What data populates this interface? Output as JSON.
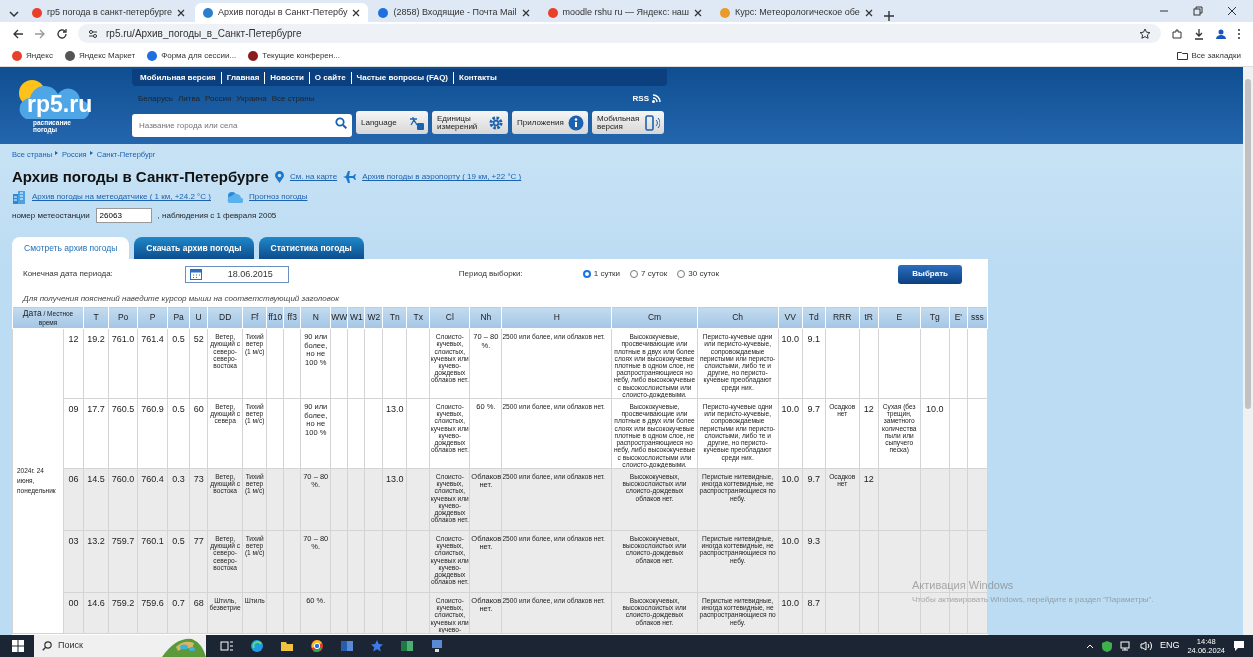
{
  "browser": {
    "tabs": [
      {
        "title": "rp5 погода в санкт-петербурге",
        "selected": false,
        "color": "#e8402a"
      },
      {
        "title": "Архив погоды в Санкт-Петербу",
        "selected": true,
        "color": "#2a7fd0"
      },
      {
        "title": "(2858) Входящие - Почта Mail",
        "selected": false,
        "color": "#1e6fe0"
      },
      {
        "title": "moodle rshu ru — Яндекс: наш",
        "selected": false,
        "color": "#e8402a"
      },
      {
        "title": "Курс: Метеорологическое обе",
        "selected": false,
        "color": "#e89a2a"
      }
    ],
    "address": "rp5.ru/Архив_погоды_в_Санкт-Петербурге",
    "bookmarks": [
      {
        "label": "Яндекс",
        "color": "#e8402a"
      },
      {
        "label": "Яндекс Маркет",
        "color": "#555555"
      },
      {
        "label": "Форма для сессии...",
        "color": "#1e6fe0"
      },
      {
        "label": "Текущие конферен...",
        "color": "#8a1c1c"
      }
    ],
    "all_bookmarks": "Все закладки"
  },
  "site": {
    "logo": "rp5.ru",
    "logo_sub": "расписание погоды",
    "top_menu": [
      "Мобильная версия",
      "Главная",
      "Новости",
      "О сайте",
      "Частые вопросы (FAQ)",
      "Контакты"
    ],
    "countries": [
      "Беларусь",
      "Литва",
      "Россия",
      "Украина",
      "Все страны"
    ],
    "rss": "RSS",
    "search_placeholder": "Название города или села",
    "header_buttons": [
      {
        "label": "Language",
        "kind": "translate"
      },
      {
        "label": "Единицы измерений",
        "kind": "gear"
      },
      {
        "label": "Приложения",
        "kind": "info"
      },
      {
        "label": "Мобильная версия",
        "kind": "phone"
      }
    ]
  },
  "breadcrumbs": [
    "Все страны",
    "Россия",
    "Санкт-Петербург"
  ],
  "title": "Архив погоды в Санкт-Петербурге",
  "map_link": "См. на карте",
  "airport_link": "Архив погоды в аэропорту ( 19 км, +22 °C )",
  "sensor_link": "Архив погоды на метеодатчике ( 1 км, +24.2 °C )",
  "forecast_link": "Прогноз погоды",
  "station_label": "номер метеостанции",
  "station": "26063",
  "since": ", наблюдения с 1 февраля 2005",
  "archive_tabs": [
    {
      "label": "Смотреть архив погоды",
      "selected": true
    },
    {
      "label": "Скачать архив погоды",
      "selected": false
    },
    {
      "label": "Статистика погоды",
      "selected": false
    }
  ],
  "form": {
    "end_date_label": "Конечная дата периода:",
    "date": "18.06.2015",
    "period_label": "Период выборки:",
    "periods": [
      {
        "label": "1 сутки",
        "selected": true
      },
      {
        "label": "7 суток",
        "selected": false
      },
      {
        "label": "30 суток",
        "selected": false
      }
    ],
    "submit": "Выбрать"
  },
  "hint": "Для получения пояснений наведите курсор мыши на соответствующий заголовок",
  "table": {
    "columns": [
      {
        "label": "Дата",
        "sub": "/ Местное время"
      },
      {
        "label": "T"
      },
      {
        "label": "Po"
      },
      {
        "label": "P"
      },
      {
        "label": "Pa"
      },
      {
        "label": "U"
      },
      {
        "label": "DD"
      },
      {
        "label": "Ff"
      },
      {
        "label": "ff10"
      },
      {
        "label": "ff3"
      },
      {
        "label": "N"
      },
      {
        "label": "WW"
      },
      {
        "label": "W1"
      },
      {
        "label": "W2"
      },
      {
        "label": "Tn"
      },
      {
        "label": "Tx"
      },
      {
        "label": "Cl"
      },
      {
        "label": "Nh"
      },
      {
        "label": "H"
      },
      {
        "label": "Cm"
      },
      {
        "label": "Ch"
      },
      {
        "label": "VV"
      },
      {
        "label": "Td"
      },
      {
        "label": "RRR"
      },
      {
        "label": "tR"
      },
      {
        "label": "E"
      },
      {
        "label": "Tg"
      },
      {
        "label": "E'"
      },
      {
        "label": "sss"
      }
    ],
    "day": "2024г. 24 июня, понедельник",
    "rows": [
      {
        "shaded": false,
        "cells": [
          "12",
          "19.2",
          "761.0",
          "761.4",
          "0.5",
          "52",
          "Ветер, дующий с северо-северо-востока",
          "Тихий ветер (1 м/с)",
          null,
          null,
          "90 или более, но не 100 %",
          null,
          null,
          null,
          null,
          null,
          "Слоисто-кучевых, слоистых, кучевых или кучево-дождевых облаков нет.",
          "70 – 80 %.",
          "2500 или более, или облаков нет.",
          "Высококучевые, просвечивающие или плотные в двух или более слоях или высококучевые плотные в одном слое, не распространяющиеся но небу, либо высококучевые с высокослоистыми или слоисто-дождевыми.",
          "Перисто-кучевые одни или перисто-кучевые, сопровождаемые перистыми или перисто-слоистыми, либо те и другие, но перисто-кучевые преобладают среди них.",
          "10.0",
          "9.1",
          null,
          null,
          null,
          null,
          null,
          null
        ]
      },
      {
        "shaded": false,
        "cells": [
          "09",
          "17.7",
          "760.5",
          "760.9",
          "0.5",
          "60",
          "Ветер, дующий с севера",
          "Тихий ветер (1 м/с)",
          null,
          null,
          "90 или более, но не 100 %",
          null,
          null,
          null,
          "13.0",
          null,
          "Слоисто-кучевых, слоистых, кучевых или кучево-дождевых облаков нет.",
          "60 %.",
          "2500 или более, или облаков нет.",
          "Высококучевые, просвечивающие или плотные в двух или более слоях или высококучевые плотные в одном слое, не распространяющиеся но небу, либо высококучевые с высокослоистыми или слоисто-дождевыми.",
          "Перисто-кучевые одни или перисто-кучевые, сопровождаемые перистыми или перисто-слоистыми, либо те и другие, но перисто-кучевые преобладают среди них.",
          "10.0",
          "9.7",
          "Осадков нет",
          "12",
          "Сухая (без трещин, заметного количества пыли или сыпучего песка)",
          "10.0",
          null,
          null
        ]
      },
      {
        "shaded": true,
        "cells": [
          "06",
          "14.5",
          "760.0",
          "760.4",
          "0.3",
          "73",
          "Ветер, дующий с востока",
          "Тихий ветер (1 м/с)",
          null,
          null,
          "70 – 80 %.",
          null,
          null,
          null,
          "13.0",
          null,
          "Слоисто-кучевых, слоистых, кучевых или кучево-дождевых облаков нет.",
          "Облаков нет.",
          "2500 или более, или облаков нет.",
          "Высококучевых, высокослоистых или слоисто-дождевых облаков нет.",
          "Перистые нитевидные, иногда когтевидные, не распространяющиеся по небу.",
          "10.0",
          "9.7",
          "Осадков нет",
          "12",
          null,
          null,
          null,
          null
        ]
      },
      {
        "shaded": true,
        "cells": [
          "03",
          "13.2",
          "759.7",
          "760.1",
          "0.5",
          "77",
          "Ветер, дующий с северо-северо-востока",
          "Тихий ветер (1 м/с)",
          null,
          null,
          "70 – 80 %.",
          null,
          null,
          null,
          null,
          null,
          "Слоисто-кучевых, слоистых, кучевых или кучево-дождевых облаков нет.",
          "Облаков нет.",
          "2500 или более, или облаков нет.",
          "Высококучевых, высокослоистых или слоисто-дождевых облаков нет.",
          "Перистые нитевидные, иногда когтевидные, не распространяющиеся по небу.",
          "10.0",
          "9.3",
          null,
          null,
          null,
          null,
          null,
          null
        ]
      },
      {
        "shaded": true,
        "cells": [
          "00",
          "14.6",
          "759.2",
          "759.6",
          "0.7",
          "68",
          "Штиль, безветрие",
          "Штиль",
          null,
          null,
          "60 %.",
          null,
          null,
          null,
          null,
          null,
          "Слоисто-кучевых, слоистых, кучевых или кучево-",
          "Облаков нет.",
          "2500 или более, или облаков нет.",
          "Высококучевых, высокослоистых или слоисто-дождевых облаков нет.",
          "Перистые нитевидные, иногда когтевидные, не распространяющиеся по небу.",
          "10.0",
          "8.7",
          null,
          null,
          null,
          null,
          null,
          null
        ]
      }
    ]
  },
  "os_notice": {
    "title": "Активация Windows",
    "text": "Чтобы активировать Windows, перейдите в раздел \"Параметры\"."
  },
  "taskbar": {
    "search": "Поиск",
    "language": "ENG",
    "time": "14:48",
    "date": "24.06.2024"
  }
}
